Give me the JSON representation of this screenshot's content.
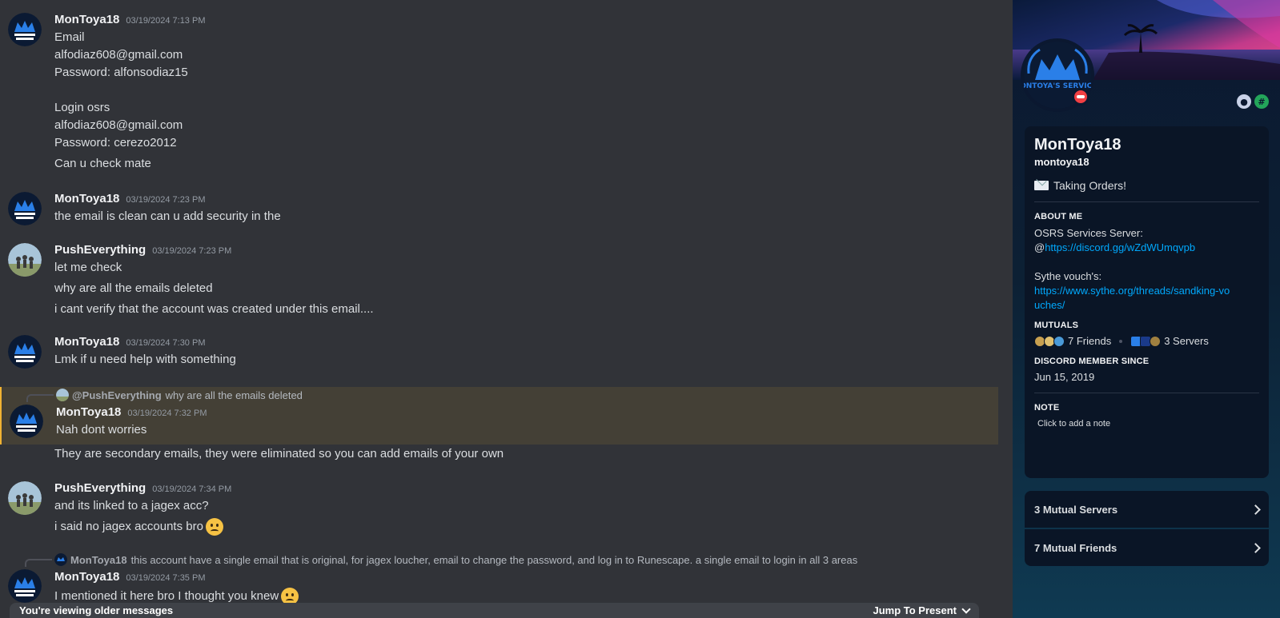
{
  "chat": {
    "messages": [
      {
        "user": "MonToya18",
        "time": "03/19/2024 7:13 PM",
        "lines": [
          "Email",
          "alfodiaz608@gmail.com",
          "Password: alfonsodiaz15",
          "Login osrs",
          "alfodiaz608@gmail.com",
          "Password: cerezo2012",
          "Can u check mate"
        ]
      },
      {
        "user": "MonToya18",
        "time": "03/19/2024 7:23 PM",
        "lines": [
          "the email is clean can u add security in the"
        ]
      },
      {
        "user": "PushEverything",
        "time": "03/19/2024 7:23 PM",
        "lines": [
          "let me check",
          "why are all the emails deleted",
          "i cant verify that the account was created under this email...."
        ]
      },
      {
        "user": "MonToya18",
        "time": "03/19/2024 7:30 PM",
        "lines": [
          "Lmk if u need help with something"
        ]
      },
      {
        "reply_user": "@PushEverything",
        "reply_text": "why are all the emails deleted",
        "user": "MonToya18",
        "time": "03/19/2024 7:32 PM",
        "lines": [
          "Nah dont worries",
          "They are secondary emails, they were eliminated so you can add emails of your own"
        ]
      },
      {
        "user": "PushEverything",
        "time": "03/19/2024 7:34 PM",
        "lines": [
          "and its linked to a jagex acc?",
          "i said no jagex accounts bro"
        ]
      },
      {
        "reply_user": "MonToya18",
        "reply_text": "this account have a single email that is original, for jagex loucher, email to change the password, and log in to Runescape. a single email to login in all 3 areas",
        "user": "MonToya18",
        "time": "03/19/2024 7:35 PM",
        "lines": [
          "I mentioned it here bro I thought you knew"
        ]
      }
    ],
    "older_bar": {
      "text": "You're viewing older messages",
      "jump": "Jump To Present"
    }
  },
  "profile": {
    "avatar_text": "MONTOYA'S SERVICES",
    "display_name": "MonToya18",
    "handle": "montoya18",
    "status": "Taking Orders!",
    "about_title": "ABOUT ME",
    "about_line1": "OSRS Services Server:",
    "about_at": "@",
    "about_link1": "https://discord.gg/wZdWUmqvpb",
    "about_line2": "Sythe vouch's:",
    "about_link2": "https://www.sythe.org/threads/sandking-vouches/",
    "mutuals_title": "MUTUALS",
    "mutual_friends": "7 Friends",
    "mutual_servers": "3 Servers",
    "member_since_title": "DISCORD MEMBER SINCE",
    "member_since": "Jun 15, 2019",
    "note_title": "NOTE",
    "note_placeholder": "Click to add a note",
    "row_servers": "3 Mutual Servers",
    "row_friends": "7 Mutual Friends"
  },
  "colors": {
    "chat_bg": "#313338",
    "highlight_bg": "#444036",
    "link": "#00a8fc",
    "dnd": "#f23f43"
  }
}
